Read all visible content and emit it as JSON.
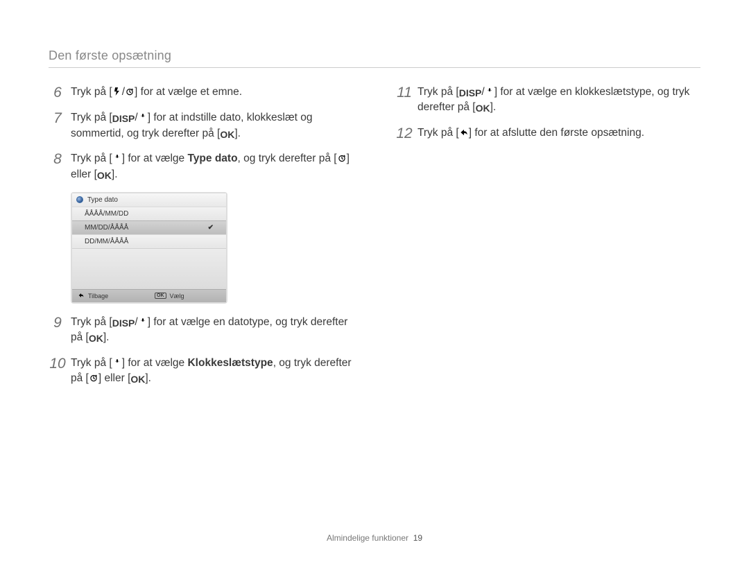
{
  "title": "Den første opsætning",
  "icons": {
    "disp": "DISP",
    "ok": "OK"
  },
  "left": {
    "s6_a": "Tryk på [",
    "s6_b": "] for at vælge et emne.",
    "s7_a": "Tryk på [",
    "s7_b": "] for at indstille dato, klokkeslæt og sommertid, og tryk derefter på [",
    "s7_c": "].",
    "s8_a": "Tryk på [",
    "s8_b": "] for at vælge ",
    "s8_bold": "Type dato",
    "s8_c": ", og tryk derefter på [",
    "s8_d": "] eller [",
    "s8_e": "].",
    "s9_a": "Tryk på [",
    "s9_b": "] for at vælge en datotype, og tryk derefter på [",
    "s9_c": "].",
    "s10_a": "Tryk på [",
    "s10_b": "] for at vælge ",
    "s10_bold": "Klokkeslætstype",
    "s10_c": ", og tryk derefter på [",
    "s10_d": "] eller [",
    "s10_e": "]."
  },
  "right": {
    "s11_a": "Tryk på [",
    "s11_b": "] for at vælge en klokkeslætstype, og tryk derefter på [",
    "s11_c": "].",
    "s12_a": "Tryk på [",
    "s12_b": "] for at afslutte den første opsætning."
  },
  "numbers": {
    "n6": "6",
    "n7": "7",
    "n8": "8",
    "n9": "9",
    "n10": "10",
    "n11": "11",
    "n12": "12"
  },
  "shot": {
    "header": "Type dato",
    "opt1": "ÅÅÅÅ/MM/DD",
    "opt2": "MM/DD/ÅÅÅÅ",
    "opt3": "DD/MM/ÅÅÅÅ",
    "back": "Tilbage",
    "select": "Vælg",
    "ok_small": "OK"
  },
  "footer": {
    "text": "Almindelige funktioner",
    "page": "19"
  }
}
